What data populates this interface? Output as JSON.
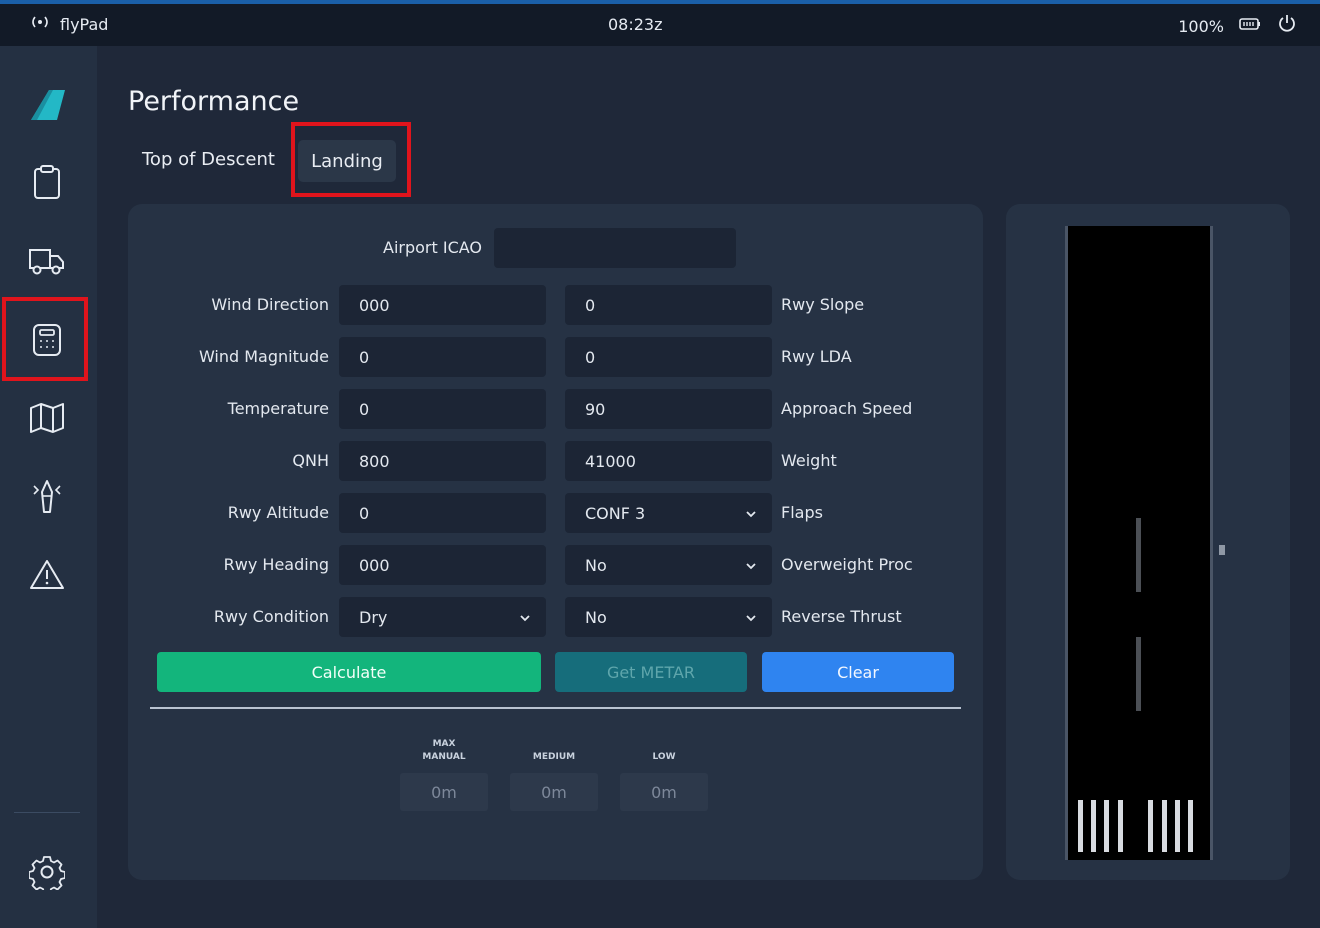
{
  "status_bar": {
    "app_name": "flyPad",
    "time": "08:23z",
    "battery": "100%"
  },
  "page": {
    "title": "Performance"
  },
  "tabs": [
    {
      "label": "Top of Descent"
    },
    {
      "label": "Landing"
    }
  ],
  "form": {
    "airport_icao": {
      "label": "Airport ICAO",
      "value": ""
    },
    "left": [
      {
        "label": "Wind Direction",
        "value": "000"
      },
      {
        "label": "Wind Magnitude",
        "value": "0"
      },
      {
        "label": "Temperature",
        "value": "0"
      },
      {
        "label": "QNH",
        "value": "800"
      },
      {
        "label": "Rwy Altitude",
        "value": "0"
      },
      {
        "label": "Rwy Heading",
        "value": "000"
      },
      {
        "label": "Rwy Condition",
        "value": "Dry"
      }
    ],
    "right": [
      {
        "label": "Rwy Slope",
        "value": "0"
      },
      {
        "label": "Rwy LDA",
        "value": "0"
      },
      {
        "label": "Approach Speed",
        "value": "90"
      },
      {
        "label": "Weight",
        "value": "41000"
      },
      {
        "label": "Flaps",
        "value": "CONF 3"
      },
      {
        "label": "Overweight Proc",
        "value": "No"
      },
      {
        "label": "Reverse Thrust",
        "value": "No"
      }
    ]
  },
  "buttons": {
    "calculate": "Calculate",
    "get_metar": "Get METAR",
    "clear": "Clear"
  },
  "results": [
    {
      "label_line1": "MAX",
      "label_line2": "MANUAL",
      "value": "0m"
    },
    {
      "label_line1": "",
      "label_line2": "MEDIUM",
      "value": "0m"
    },
    {
      "label_line1": "",
      "label_line2": "LOW",
      "value": "0m"
    }
  ],
  "colors": {
    "accent_green": "#13b57c",
    "accent_blue": "#2f84f0",
    "highlight_red": "#e0141c"
  }
}
